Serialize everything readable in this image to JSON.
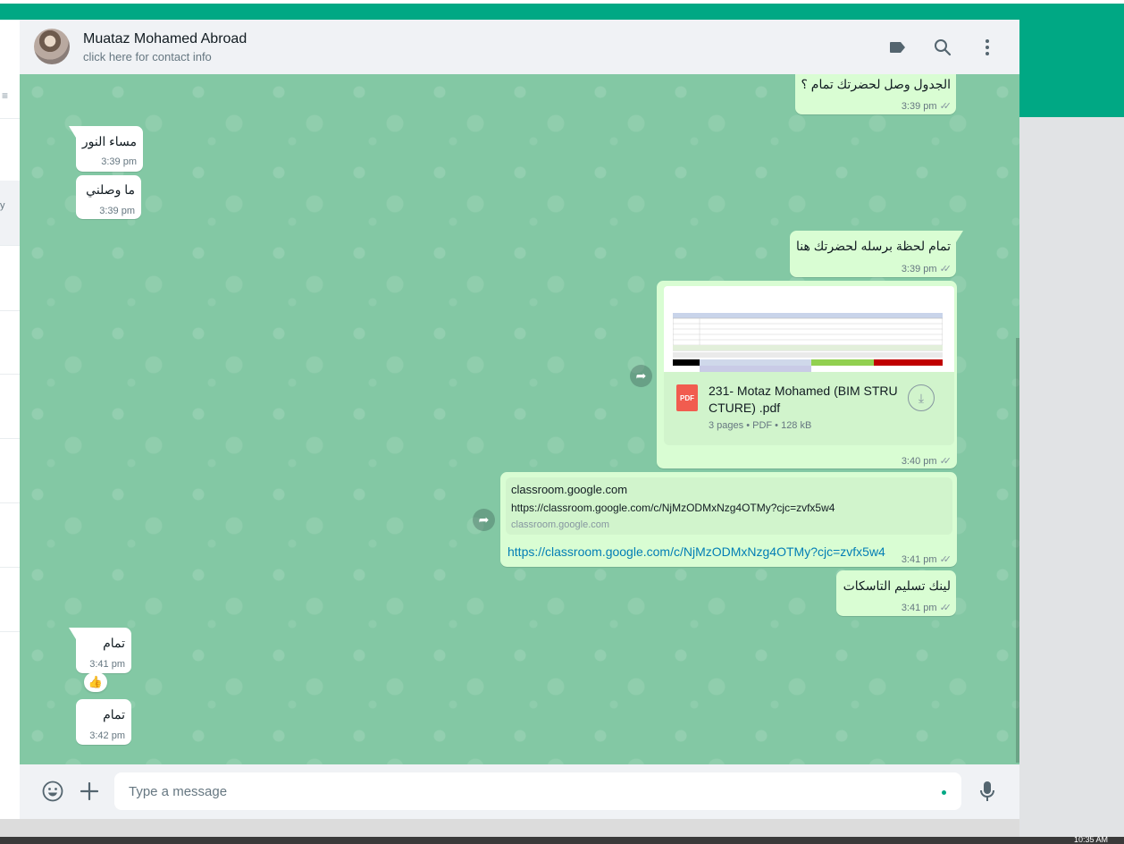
{
  "header": {
    "contact_name": "Muataz Mohamed Abroad",
    "contact_sub": "click here for contact info",
    "icons": [
      "label-icon",
      "search-icon",
      "menu-icon"
    ]
  },
  "left_panel": {
    "partial_label": "y"
  },
  "messages": [
    {
      "dir": "out",
      "text": "الجدول وصل لحضرتك تمام ؟",
      "time": "3:39 pm",
      "status": "read"
    },
    {
      "dir": "in",
      "text": "مساء النور",
      "time": "3:39 pm"
    },
    {
      "dir": "in",
      "text": "ما وصلني",
      "time": "3:39 pm"
    },
    {
      "dir": "out",
      "text": "تمام لحظة برسله لحضرتك هنا",
      "time": "3:39 pm",
      "status": "read"
    },
    {
      "dir": "out",
      "type": "document",
      "icon_label": "PDF",
      "file_name": "231- Motaz Mohamed (BIM STRUCTURE) .pdf",
      "file_name_line1": "231- Motaz Mohamed (BIM STRU",
      "file_name_line2": "CTURE) .pdf",
      "file_info": "3 pages • PDF • 128 kB",
      "time": "3:40 pm",
      "status": "read"
    },
    {
      "dir": "out",
      "type": "link",
      "preview_title": "classroom.google.com",
      "preview_desc": "https://classroom.google.com/c/NjMzODMxNzg4OTMy?cjc=zvfx5w4",
      "preview_domain": "classroom.google.com",
      "url": "https://classroom.google.com/c/NjMzODMxNzg4OTMy?cjc=zvfx5w4",
      "time": "3:41 pm",
      "status": "read"
    },
    {
      "dir": "out",
      "text": "لينك تسليم التاسكات",
      "time": "3:41 pm",
      "status": "read"
    },
    {
      "dir": "in",
      "text": "تمام",
      "time": "3:41 pm",
      "reaction": "👍"
    },
    {
      "dir": "in",
      "text": "تمام",
      "time": "3:42 pm"
    }
  ],
  "composer": {
    "placeholder": "Type a message"
  },
  "colors": {
    "accent": "#00a884",
    "outgoing_bubble": "#d9fdd3",
    "incoming_bubble": "#ffffff",
    "wallpaper": "#83c8a4",
    "link": "#027eb5"
  },
  "taskbar": {
    "clock_fragment": "10:35 AM"
  }
}
